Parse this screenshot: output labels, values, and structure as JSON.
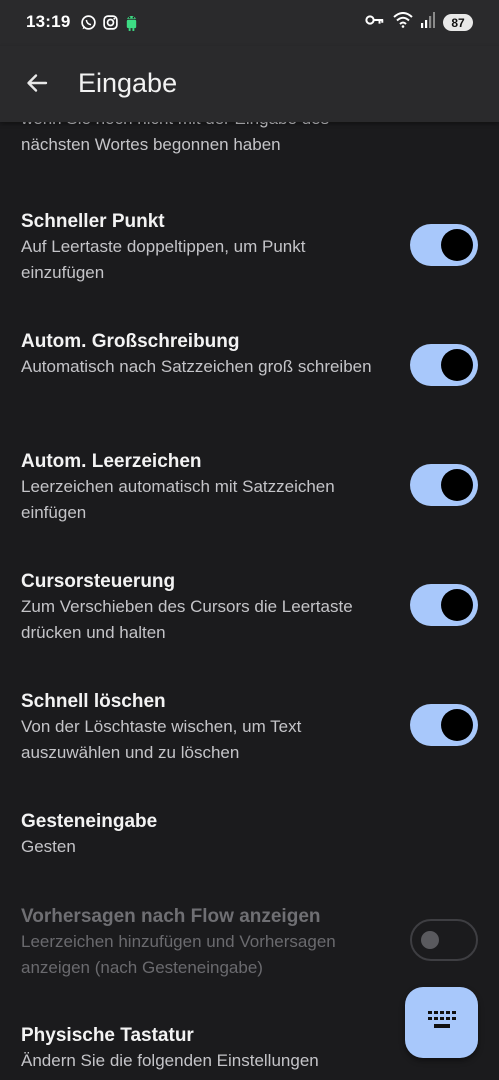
{
  "status_bar": {
    "time": "13:19",
    "battery": "87",
    "left_icons": [
      "whatsapp-icon",
      "instagram-icon",
      "android-icon"
    ],
    "right_icons": [
      "vpn-key-icon",
      "wifi-icon",
      "signal-icon"
    ]
  },
  "app_bar": {
    "title": "Eingabe",
    "back_icon": "arrow-back-icon"
  },
  "partial_item": {
    "subtitle": "wenn Sie noch nicht mit der Eingabe des nächsten Wortes begonnen haben"
  },
  "settings": [
    {
      "title": "Schneller Punkt",
      "subtitle": "Auf Leertaste doppeltippen, um Punkt einzufügen",
      "toggle": true
    },
    {
      "title": "Autom. Großschreibung",
      "subtitle": "Automatisch nach Satzzeichen groß schreiben",
      "toggle": true
    },
    {
      "title": "Autom. Leerzeichen",
      "subtitle": "Leerzeichen automatisch mit Satzzeichen einfügen",
      "toggle": true
    },
    {
      "title": "Cursorsteuerung",
      "subtitle": "Zum Verschieben des Cursors die Leertaste drücken und halten",
      "toggle": true
    },
    {
      "title": "Schnell löschen",
      "subtitle": "Von der Löschtaste wischen, um Text auszuwählen und zu löschen",
      "toggle": true
    },
    {
      "title": "Gesteneingabe",
      "subtitle": "Gesten"
    },
    {
      "title": "Vorhersagen nach Flow anzeigen",
      "subtitle": "Leerzeichen hinzufügen und Vorhersagen anzeigen (nach Gesteneingabe)",
      "toggle": false,
      "disabled": true
    },
    {
      "title": "Physische Tastatur",
      "subtitle": "Ändern Sie die folgenden Einstellungen"
    }
  ],
  "fab": {
    "icon": "keyboard-icon"
  },
  "colors": {
    "background": "#1b1b1d",
    "toggle_on": "#a8c8fb",
    "appbar": "#2a2a2c"
  }
}
